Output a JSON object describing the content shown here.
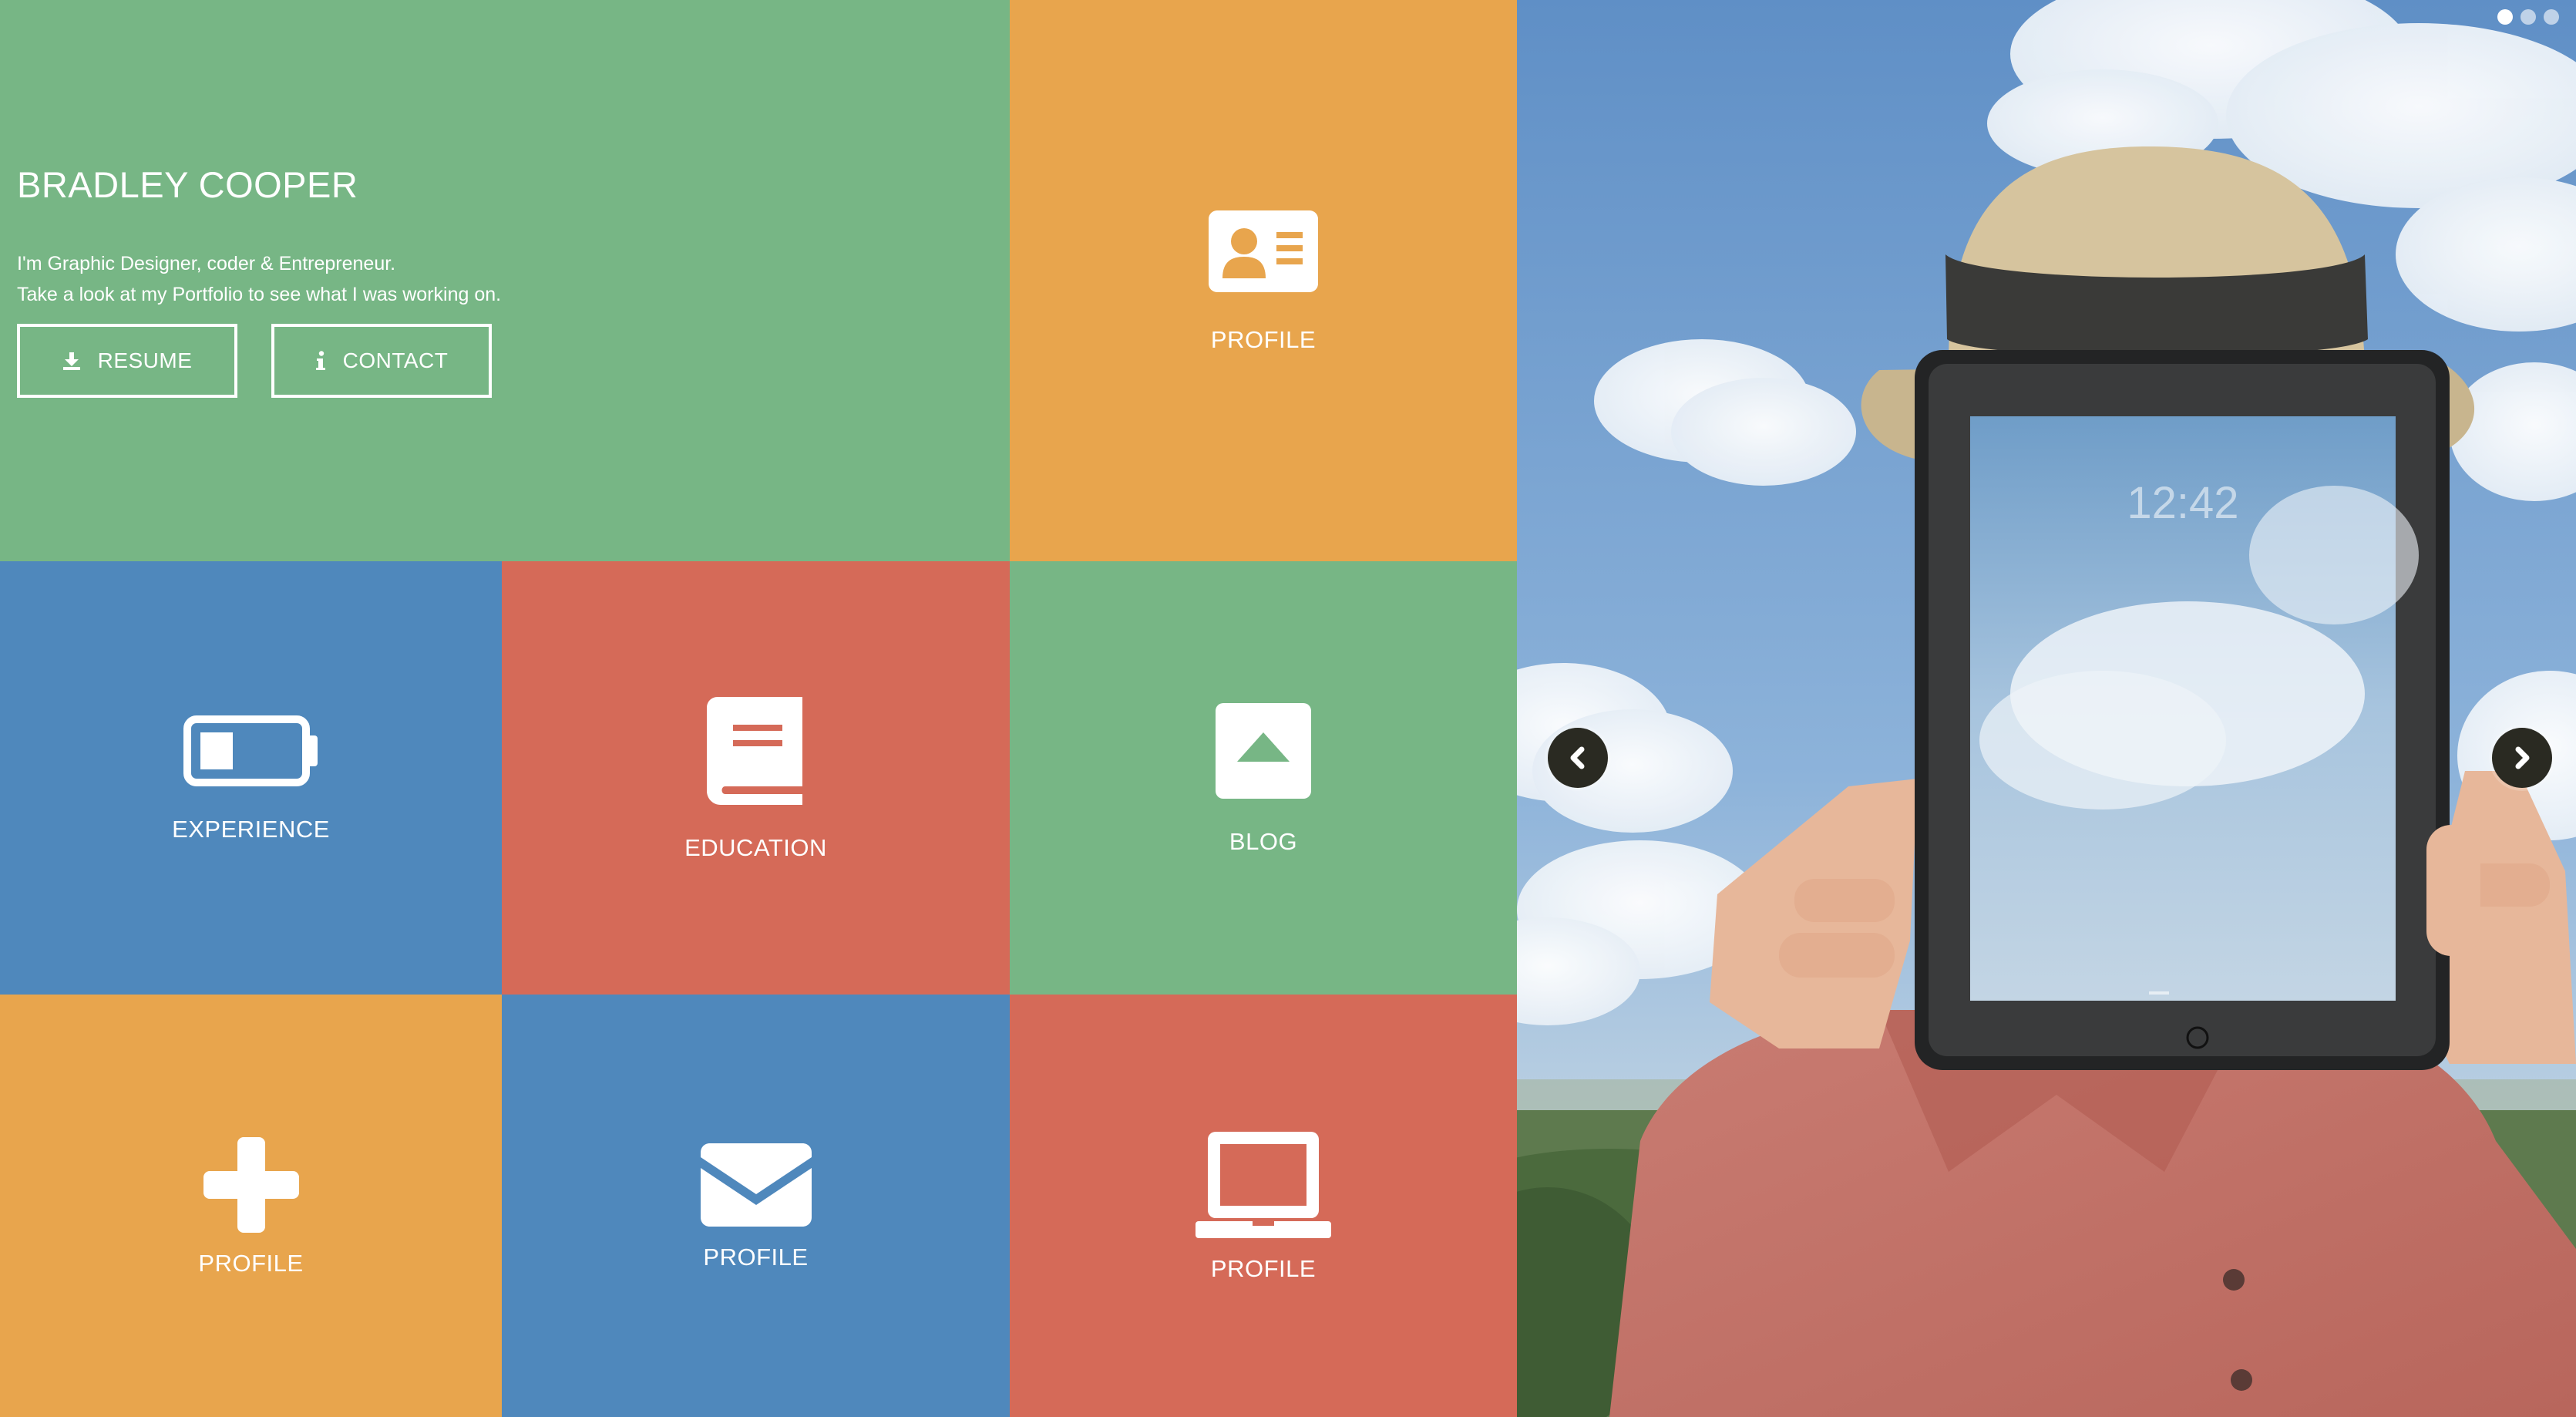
{
  "hero": {
    "name": "BRADLEY COOPER",
    "bio_line1": "I'm Graphic Designer, coder & Entrepreneur.",
    "bio_line2": "Take a look at my Portfolio to see what I was working on.",
    "resume_label": "RESUME",
    "contact_label": "CONTACT"
  },
  "tiles": {
    "profile_top": {
      "label": "PROFILE",
      "icon": "id-card-icon",
      "color": "#e8a54d"
    },
    "experience": {
      "label": "EXPERIENCE",
      "icon": "battery-icon",
      "color": "#4f88bc"
    },
    "education": {
      "label": "EDUCATION",
      "icon": "book-icon",
      "color": "#d56a58"
    },
    "blog": {
      "label": "BLOG",
      "icon": "caret-up-square-icon",
      "color": "#77b685"
    },
    "profile_plus": {
      "label": "PROFILE",
      "icon": "plus-icon",
      "color": "#e8a54d"
    },
    "profile_mail": {
      "label": "PROFILE",
      "icon": "envelope-icon",
      "color": "#4f88bc"
    },
    "profile_laptop": {
      "label": "PROFILE",
      "icon": "laptop-icon",
      "color": "#d56a58"
    }
  },
  "slider": {
    "image": "man-holding-tablet-against-sky",
    "tablet_clock": "12:42",
    "active_slide": 1,
    "slide_count": 3
  },
  "colors": {
    "green": "#77b685",
    "orange": "#e8a54d",
    "blue": "#4f88bc",
    "red": "#d56a58"
  }
}
